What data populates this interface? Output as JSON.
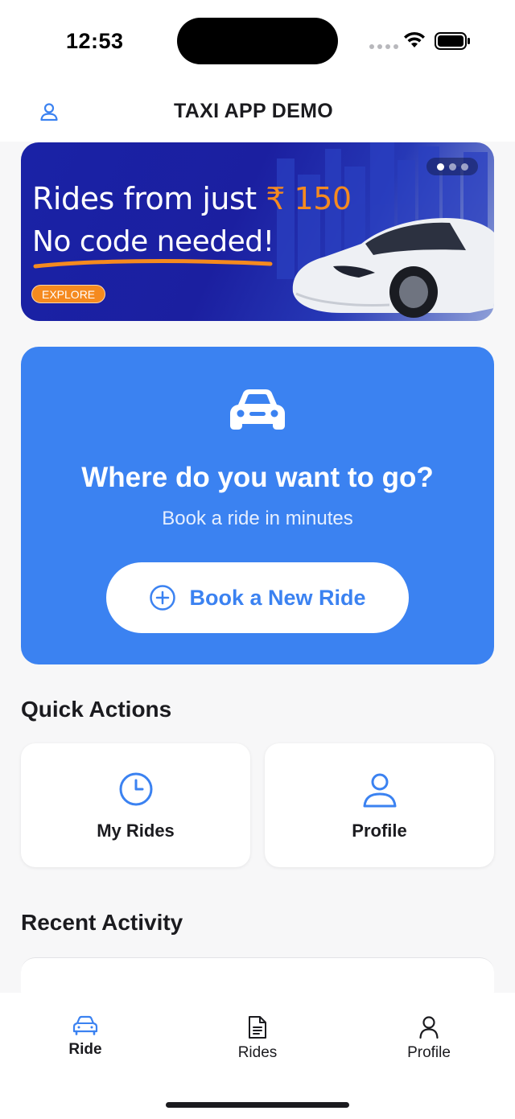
{
  "status_bar": {
    "time": "12:53"
  },
  "header": {
    "title": "TAXI APP DEMO",
    "profile_icon": "person-icon"
  },
  "banner": {
    "headline_prefix": "Rides from just ",
    "price": "₹ 150",
    "headline_line2": "No code needed!",
    "cta": "EXPLORE",
    "page_count": 3,
    "active_page": 1,
    "colors": {
      "accent": "#f58a1f",
      "background": "#1b1fa0"
    }
  },
  "hero": {
    "title": "Where do you want to go?",
    "subtitle": "Book a ride in minutes",
    "button_label": "Book a New Ride",
    "icon": "car-icon",
    "color": "#3b82f1"
  },
  "quick_actions": {
    "title": "Quick Actions",
    "items": [
      {
        "label": "My Rides",
        "icon": "clock-icon"
      },
      {
        "label": "Profile",
        "icon": "person-icon"
      }
    ]
  },
  "recent_activity": {
    "title": "Recent Activity"
  },
  "tabbar": {
    "items": [
      {
        "label": "Ride",
        "icon": "car-icon",
        "active": true
      },
      {
        "label": "Rides",
        "icon": "document-icon",
        "active": false
      },
      {
        "label": "Profile",
        "icon": "person-icon",
        "active": false
      }
    ]
  }
}
